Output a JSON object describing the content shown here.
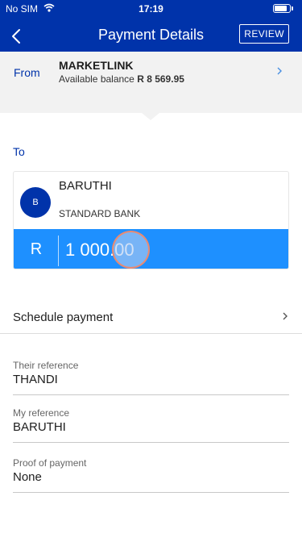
{
  "status_bar": {
    "carrier": "No SIM",
    "time": "17:19",
    "battery_level": 0.85
  },
  "header": {
    "title": "Payment Details",
    "review_label": "REVIEW"
  },
  "from": {
    "label": "From",
    "account_name": "MARKETLINK",
    "balance_label": "Available balance",
    "balance_amount": "R 8 569.95"
  },
  "to": {
    "label": "To",
    "recipient_initial": "B",
    "recipient_name": "BARUTHI",
    "recipient_bank": "STANDARD BANK"
  },
  "amount": {
    "currency": "R",
    "value": "1 000.00"
  },
  "schedule": {
    "label": "Schedule payment"
  },
  "fields": {
    "their_reference": {
      "label": "Their reference",
      "value": "THANDI"
    },
    "my_reference": {
      "label": "My reference",
      "value": "BARUTHI"
    },
    "proof_of_payment": {
      "label": "Proof of payment",
      "value": "None"
    }
  },
  "colors": {
    "brand": "#0033aa",
    "accent": "#1e90ff",
    "panel": "#f2f2f2"
  },
  "icons": {
    "back": "chevron-left-icon",
    "forward": "chevron-right-icon",
    "wifi": "wifi-icon",
    "battery": "battery-icon"
  }
}
